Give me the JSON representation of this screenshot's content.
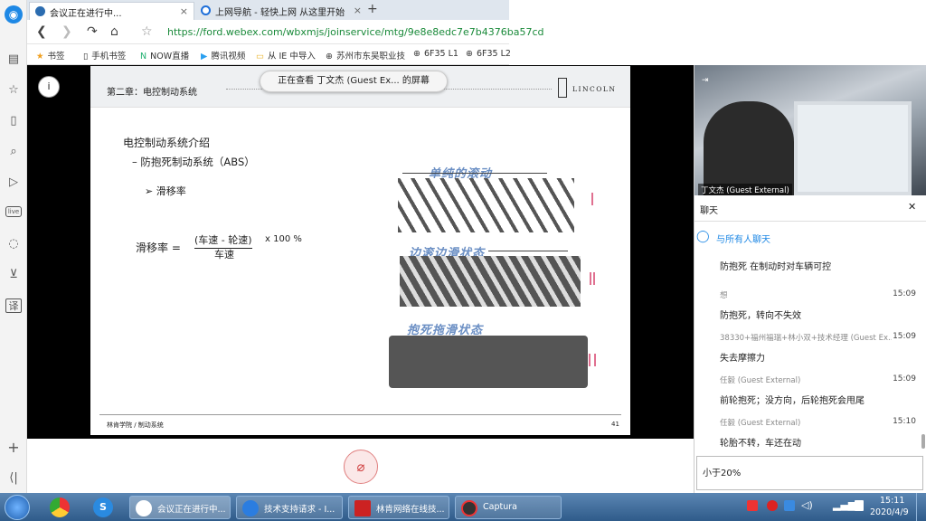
{
  "sidebar": {
    "icons": [
      "logo-icon",
      "notes-icon",
      "star-icon",
      "book-icon",
      "search-icon",
      "video-icon",
      "live-icon",
      "chat-bubble-icon",
      "cart-icon",
      "translate-icon",
      "add-icon",
      "collapse-icon"
    ]
  },
  "tabs": [
    {
      "label": "会议正在进行中...",
      "close": "×"
    },
    {
      "label": "上网导航 - 轻快上网 从这里开始",
      "close": "×"
    }
  ],
  "new_tab": "+",
  "address": {
    "url": "https://ford.webex.com/wbxmjs/joinservice/mtg/9e8e8edc7e7b4376ba57cd"
  },
  "bookmarks": [
    "书签",
    "手机书签",
    "NOW直播",
    "腾讯视频",
    "从 IE 中导入",
    "苏州市东吴职业技",
    "6F35 L1",
    "6F35 L2"
  ],
  "meeting": {
    "share_banner": "正在查看 丁文杰 (Guest Ex... 的屏幕",
    "info_label": "i"
  },
  "slide": {
    "header": "第二章：电控制动系统",
    "brand": "LINCOLN",
    "title": "电控制动系统介绍",
    "subtitle": "– 防抱死制动系统（ABS）",
    "bullet": "➢  滑移率",
    "formula_label": "滑移率 =",
    "formula_num": "(车速 - 轮速)",
    "formula_den": "车速",
    "formula_tail": "x 100 %",
    "label1": "单纯的滚动",
    "label2": "边滚边滑状态",
    "label3": "抱死拖滑状态",
    "footer": "林肯学院 / 制动系统",
    "page": "41"
  },
  "video": {
    "name": "丁文杰 (Guest External)"
  },
  "chat": {
    "title": "聊天",
    "to": "与所有人聊天",
    "messages": [
      {
        "who": "",
        "time": "",
        "text": "防抱死 在制动时对车辆可控"
      },
      {
        "who": "想",
        "time": "15:09",
        "text": "防抱死，转向不失效"
      },
      {
        "who": "38330+福州福瑞+林小双+技术经理 (Guest Ex...",
        "time": "15:09",
        "text": "失去摩擦力"
      },
      {
        "who": "任毅 (Guest External)",
        "time": "15:09",
        "text": "前轮抱死；没方向，后轮抱死会甩尾"
      },
      {
        "who": "任毅 (Guest External)",
        "time": "15:10",
        "text": "轮胎不转，车还在动"
      }
    ],
    "input_value": "小于20%"
  },
  "taskbar": {
    "items": [
      "会议正在进行中...",
      "技术支持请求 - I...",
      "林肯网络在线技...",
      "Captura"
    ],
    "time": "15:11",
    "date": "2020/4/9"
  }
}
